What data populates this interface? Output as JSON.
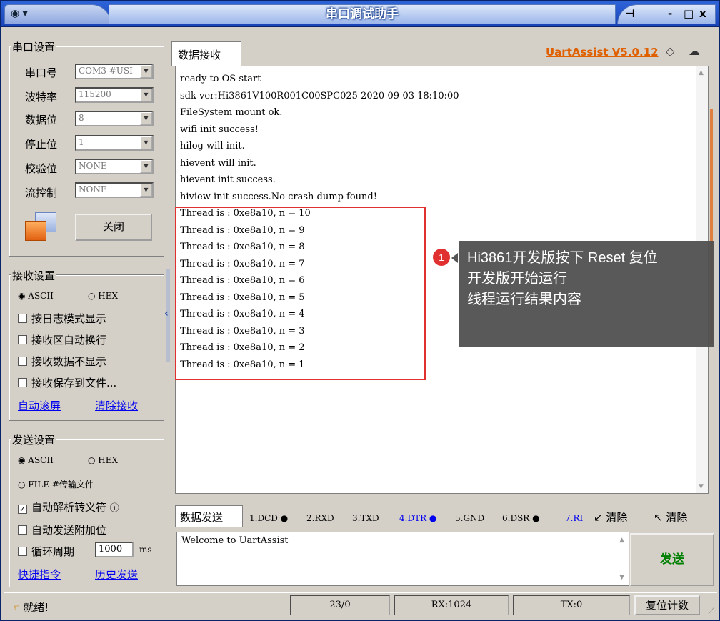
{
  "window": {
    "title": "串口调试助手",
    "menu_icon": "▾",
    "pin_icon": "pin-icon",
    "min_label": "-",
    "max_label": "□",
    "close_label": "x"
  },
  "serial_settings": {
    "title": "串口设置",
    "port_label": "串口号",
    "port_value": "COM3 #USI",
    "baud_label": "波特率",
    "baud_value": "115200",
    "databits_label": "数据位",
    "databits_value": "8",
    "stopbits_label": "停止位",
    "stopbits_value": "1",
    "parity_label": "校验位",
    "parity_value": "NONE",
    "flow_label": "流控制",
    "flow_value": "NONE",
    "toggle_button": "关闭"
  },
  "receive_settings": {
    "title": "接收设置",
    "ascii_label": "ASCII",
    "hex_label": "HEX",
    "log_mode": "按日志模式显示",
    "auto_wrap": "接收区自动换行",
    "hide_data": "接收数据不显示",
    "save_file": "接收保存到文件...",
    "auto_scroll": "自动滚屏",
    "clear_recv": "清除接收"
  },
  "send_settings": {
    "title": "发送设置",
    "ascii_label": "ASCII",
    "hex_label": "HEX",
    "file_label": "FILE #传输文件",
    "escape_parse": "自动解析转义符",
    "append_check": "自动发送附加位",
    "cycle_label": "循环周期",
    "cycle_value": "1000",
    "cycle_unit": "ms",
    "shortcut": "快捷指令",
    "history": "历史发送"
  },
  "receive_panel": {
    "tab_label": "数据接收",
    "version": "UartAssist V5.0.12",
    "lines": [
      "ready to OS start",
      "sdk ver:Hi3861V100R001C00SPC025 2020-09-03 18:10:00",
      "FileSystem mount ok.",
      "wifi init success!",
      "hilog will init.",
      "hievent will init.",
      "hievent init success.",
      "hiview init success.No crash dump found!",
      "Thread is : 0xe8a10, n = 10",
      "Thread is : 0xe8a10, n = 9",
      "Thread is : 0xe8a10, n = 8",
      "Thread is : 0xe8a10, n = 7",
      "Thread is : 0xe8a10, n = 6",
      "Thread is : 0xe8a10, n = 5",
      "Thread is : 0xe8a10, n = 4",
      "Thread is : 0xe8a10, n = 3",
      "Thread is : 0xe8a10, n = 2",
      "Thread is : 0xe8a10, n = 1"
    ]
  },
  "callout": {
    "number": "1",
    "line1": "Hi3861开发版按下 Reset 复位",
    "line2": "开发版开始运行",
    "line3": "线程运行结果内容"
  },
  "send_panel": {
    "tab_label": "数据发送",
    "pins": [
      "1.DCD",
      "2.RXD",
      "3.TXD",
      "4.DTR",
      "5.GND",
      "6.DSR",
      "7.RI"
    ],
    "clear1": "清除",
    "clear2": "清除",
    "send_text": "Welcome to UartAssist",
    "send_button": "发送"
  },
  "status": {
    "ready": "就绪!",
    "counts": "23/0",
    "rx": "RX:1024",
    "tx": "TX:0",
    "reset_button": "复位计数"
  },
  "colors": {
    "accent": "#e06000",
    "highlight": "#e03030",
    "send_green": "#008000"
  }
}
